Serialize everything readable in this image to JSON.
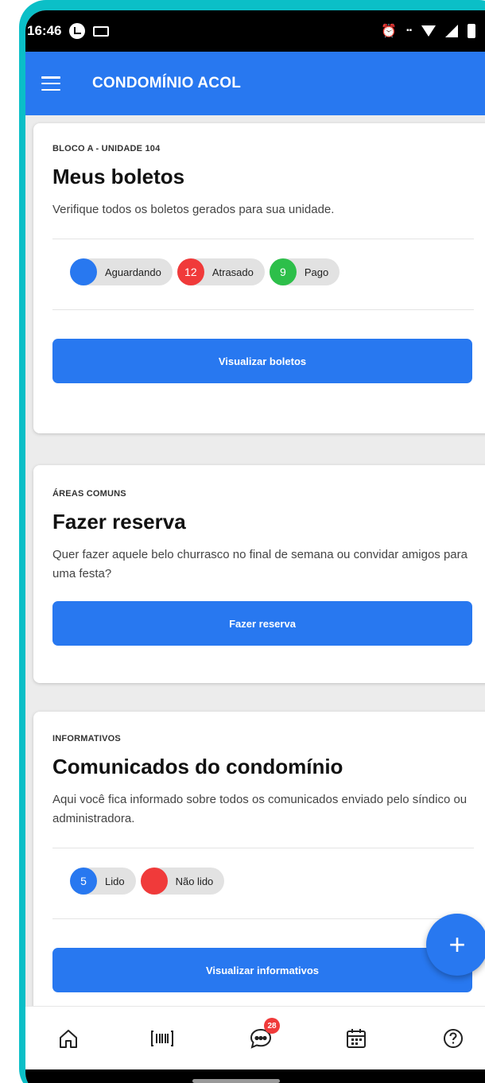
{
  "status_bar": {
    "time": "16:46",
    "battery": "67"
  },
  "app_bar": {
    "title": "CONDOMÍNIO ACOL"
  },
  "boletos_card": {
    "overline": "BLOCO A - UNIDADE 104",
    "title": "Meus boletos",
    "description": "Verifique todos os boletos gerados para sua unidade.",
    "chips": [
      {
        "count": "",
        "label": "Aguardando",
        "color": "#2878f0"
      },
      {
        "count": "12",
        "label": "Atrasado",
        "color": "#f03a3a"
      },
      {
        "count": "9",
        "label": "Pago",
        "color": "#2dbf4a"
      }
    ],
    "button_label": "Visualizar boletos"
  },
  "reserva_card": {
    "overline": "ÁREAS COMUNS",
    "title": "Fazer reserva",
    "description": "Quer fazer aquele belo churrasco no final de semana ou convidar amigos para uma festa?",
    "button_label": "Fazer reserva"
  },
  "comunicados_card": {
    "overline": "INFORMATIVOS",
    "title": "Comunicados do condomínio",
    "description": "Aqui você fica informado sobre todos os comunicados enviado pelo síndico ou administradora.",
    "chips": [
      {
        "count": "5",
        "label": "Lido",
        "color": "#2878f0"
      },
      {
        "count": "",
        "label": "Não lido",
        "color": "#f03a3a"
      }
    ],
    "button_label": "Visualizar informativos"
  },
  "fab": {
    "icon": "plus-icon",
    "label": "+"
  },
  "bottom_nav": {
    "items": [
      {
        "icon": "home-icon"
      },
      {
        "icon": "barcode-icon"
      },
      {
        "icon": "chat-icon",
        "badge": "28"
      },
      {
        "icon": "calendar-icon"
      },
      {
        "icon": "help-icon"
      }
    ]
  },
  "colors": {
    "primary": "#2878f0",
    "danger": "#f03a3a",
    "success": "#2dbf4a",
    "frame": "#0bbfc7"
  }
}
